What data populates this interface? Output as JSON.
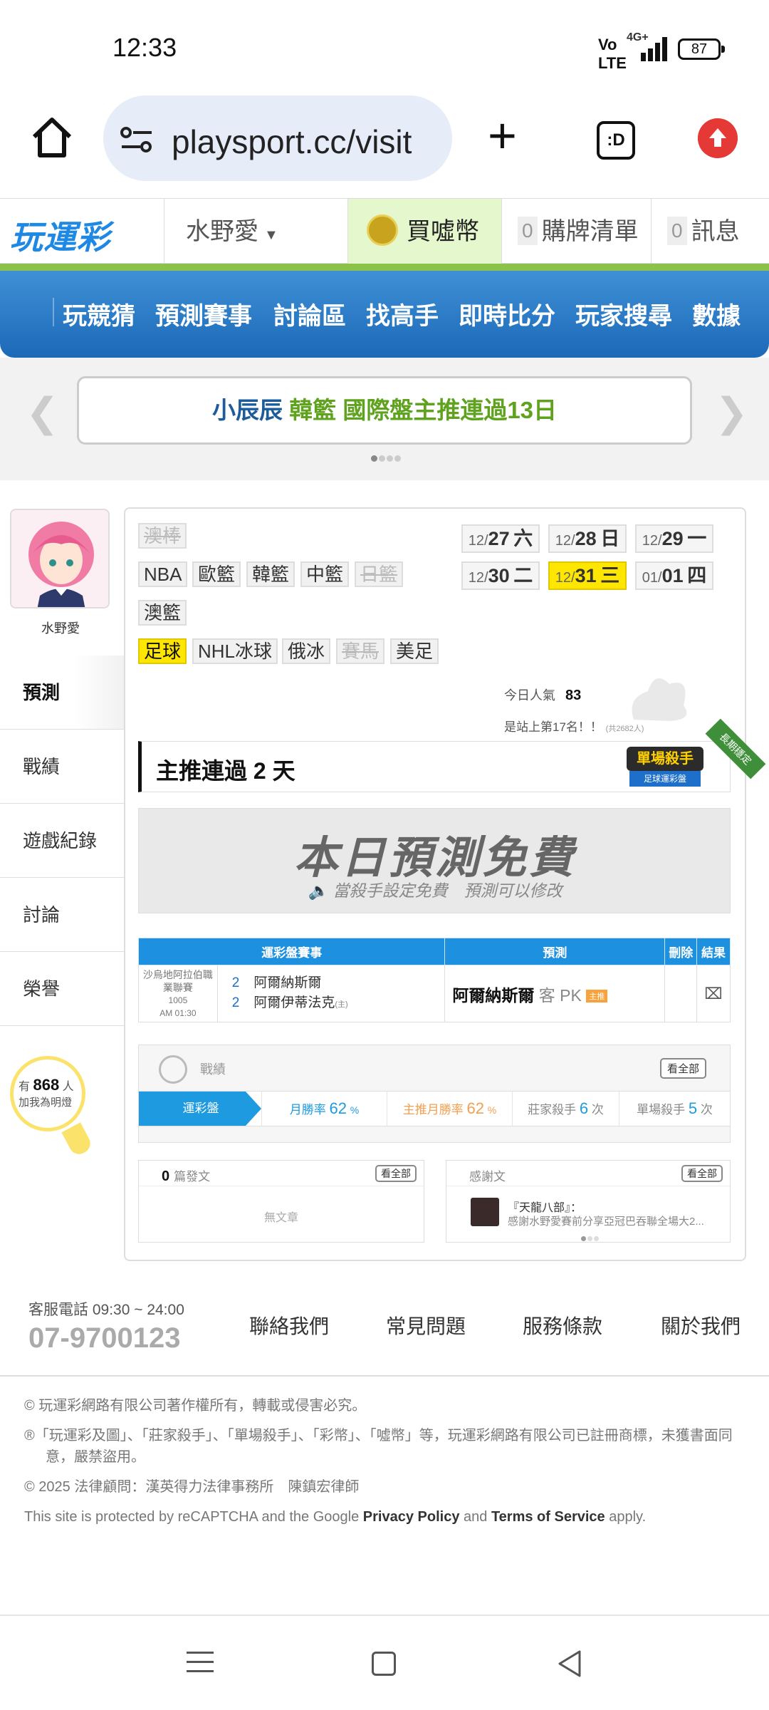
{
  "status_bar": {
    "time": "12:33",
    "network": "4G+",
    "battery": "87"
  },
  "browser": {
    "url": "playsport.cc/visit",
    "tabs_label": ":D"
  },
  "header": {
    "logo": "玩運彩",
    "username": "水野愛",
    "buy_label": "買噓幣",
    "cart_count": "0",
    "cart_label": "購牌清單",
    "msg_count": "0",
    "msg_label": "訊息"
  },
  "nav": {
    "items": [
      "玩競猜",
      "預測賽事",
      "討論區",
      "找高手",
      "即時比分",
      "玩家搜尋",
      "數據"
    ]
  },
  "banner": {
    "name": "小辰辰",
    "sport": "韓籃",
    "text": "國際盤主推連過13日"
  },
  "profile": {
    "name": "水野愛"
  },
  "side_menu": [
    "預測",
    "戰績",
    "遊戲紀錄",
    "討論",
    "榮譽"
  ],
  "bulb": {
    "prefix": "有",
    "count": "868",
    "suffix": "人",
    "line2": "加我為明燈"
  },
  "sports": {
    "row1": [
      "澳棒"
    ],
    "row2": [
      "NBA",
      "歐籃",
      "韓籃",
      "中籃",
      "日籃"
    ],
    "row3": [
      "澳籃"
    ],
    "row4": [
      "足球",
      "NHL冰球",
      "俄冰",
      "賽馬",
      "美足"
    ]
  },
  "dates": [
    {
      "m": "12/",
      "d": "27",
      "w": "六"
    },
    {
      "m": "12/",
      "d": "28",
      "w": "日"
    },
    {
      "m": "12/",
      "d": "29",
      "w": "一"
    },
    {
      "m": "12/",
      "d": "30",
      "w": "二"
    },
    {
      "m": "12/",
      "d": "31",
      "w": "三"
    },
    {
      "m": "01/",
      "d": "01",
      "w": "四"
    }
  ],
  "popularity": {
    "label": "今日人氣",
    "value": "83",
    "rank_text": "是站上第17名！！",
    "rank_total": "(共2682人)"
  },
  "streak": {
    "text": "主推連過 2 天",
    "badge_main": "單場殺手",
    "badge_sub": "足球運彩盤",
    "ribbon": "長期穩定"
  },
  "free": {
    "title": "本日預測免費",
    "subtitle": "當殺手設定免費　預測可以修改"
  },
  "table": {
    "headers": [
      "運彩盤賽事",
      "預測",
      "刪除",
      "結果"
    ],
    "rows": [
      {
        "league": "沙烏地阿拉伯職業聯賽",
        "game_no": "1005",
        "time": "AM 01:30",
        "team1_num": "2",
        "team1": "阿爾納斯爾",
        "team2_num": "2",
        "team2": "阿爾伊蒂法克",
        "home_mark": "(主)",
        "pick": "阿爾納斯爾",
        "pick_type": "客 PK",
        "pick_tag": "主推"
      }
    ]
  },
  "record": {
    "label": "戰績",
    "view_all": "看全部",
    "tab": "運彩盤",
    "month_rate_label": "月勝率",
    "month_rate": "62",
    "main_rate_label": "主推月勝率",
    "main_rate": "62",
    "pct": "%",
    "banker_label": "莊家殺手",
    "banker": "6",
    "single_label": "單場殺手",
    "single": "5",
    "unit": "次"
  },
  "articles": {
    "count": "0",
    "label": "篇發文",
    "view_all": "看全部",
    "empty": "無文章"
  },
  "thanks": {
    "label": "感謝文",
    "view_all": "看全部",
    "title": "『天龍八部』：",
    "preview": "感謝水野愛賽前分享亞冠巴吞聯全場大2..."
  },
  "footer": {
    "hours": "客服電話 09:30 ~ 24:00",
    "phone": "07-9700123",
    "links": [
      "聯絡我們",
      "常見問題",
      "服務條款",
      "關於我們"
    ],
    "copyright": "© 玩運彩網路有限公司著作權所有，轉載或侵害必究。",
    "trademark": "®「玩運彩及圖」、「莊家殺手」、「單場殺手」、「彩幣」、「噓幣」等，玩運彩網路有限公司已註冊商標，未獲書面同意，嚴禁盜用。",
    "legal": "© 2025 法律顧問：漢英得力法律事務所　陳鎮宏律師",
    "recaptcha_prefix": "This site is protected by reCAPTCHA and the Google",
    "privacy": "Privacy Policy",
    "and": "and",
    "terms": "Terms of Service",
    "apply": "apply."
  },
  "colors": {
    "nav_blue": "#1c69b8",
    "accent_green": "#8bc34a",
    "active_yellow": "#ffe600",
    "table_blue": "#1e90e0"
  }
}
